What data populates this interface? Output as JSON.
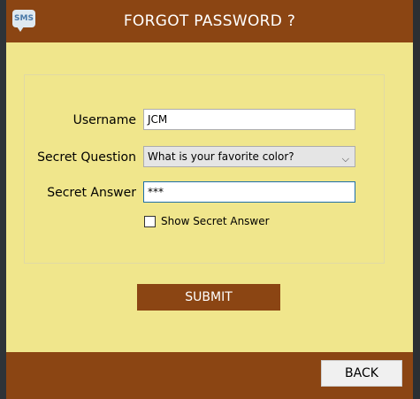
{
  "window": {
    "title": "FORGOT PASSWORD ?",
    "app_icon_text": "SMS"
  },
  "form": {
    "username_label": "Username",
    "username_value": "JCM",
    "question_label": "Secret Question",
    "question_value": "What is your favorite color?",
    "answer_label": "Secret Answer",
    "answer_value": "***",
    "show_answer_label": "Show Secret Answer",
    "show_answer_checked": false
  },
  "actions": {
    "submit_label": "SUBMIT",
    "back_label": "BACK"
  },
  "colors": {
    "brand_brown": "#8b4513",
    "form_background": "#f0e68c"
  }
}
